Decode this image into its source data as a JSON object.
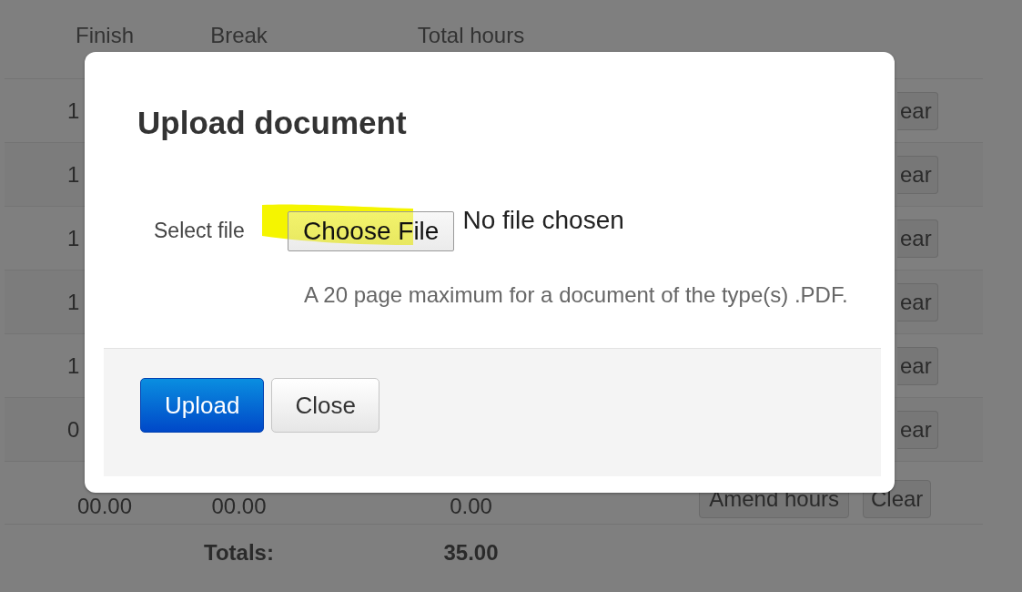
{
  "table": {
    "columns": [
      "Finish",
      "Break",
      "Total hours"
    ],
    "rows": [
      {
        "kind": "covered",
        "finish": "1",
        "clear": "ear"
      },
      {
        "kind": "covered",
        "finish": "1",
        "clear": "ear"
      },
      {
        "kind": "covered",
        "finish": "1",
        "clear": "ear"
      },
      {
        "kind": "covered",
        "finish": "1",
        "clear": "ear"
      },
      {
        "kind": "covered",
        "finish": "1",
        "clear": "ear"
      },
      {
        "kind": "covered",
        "finish": "0",
        "clear": "ear"
      },
      {
        "kind": "full",
        "finish": "00.00",
        "break": "00.00",
        "total": "0.00",
        "amend": "Amend hours",
        "clear": "Clear"
      }
    ],
    "totals": {
      "label": "Totals:",
      "value": "35.00"
    }
  },
  "modal": {
    "title": "Upload document",
    "field_label": "Select file",
    "file_button": {
      "label": "Choose File",
      "highlighted": true
    },
    "file_status": "No file chosen",
    "hint": "A 20 page maximum for a document of the type(s) .PDF.",
    "buttons": [
      {
        "label": "Upload",
        "kind": "primary"
      },
      {
        "label": "Close",
        "kind": "default"
      }
    ]
  }
}
